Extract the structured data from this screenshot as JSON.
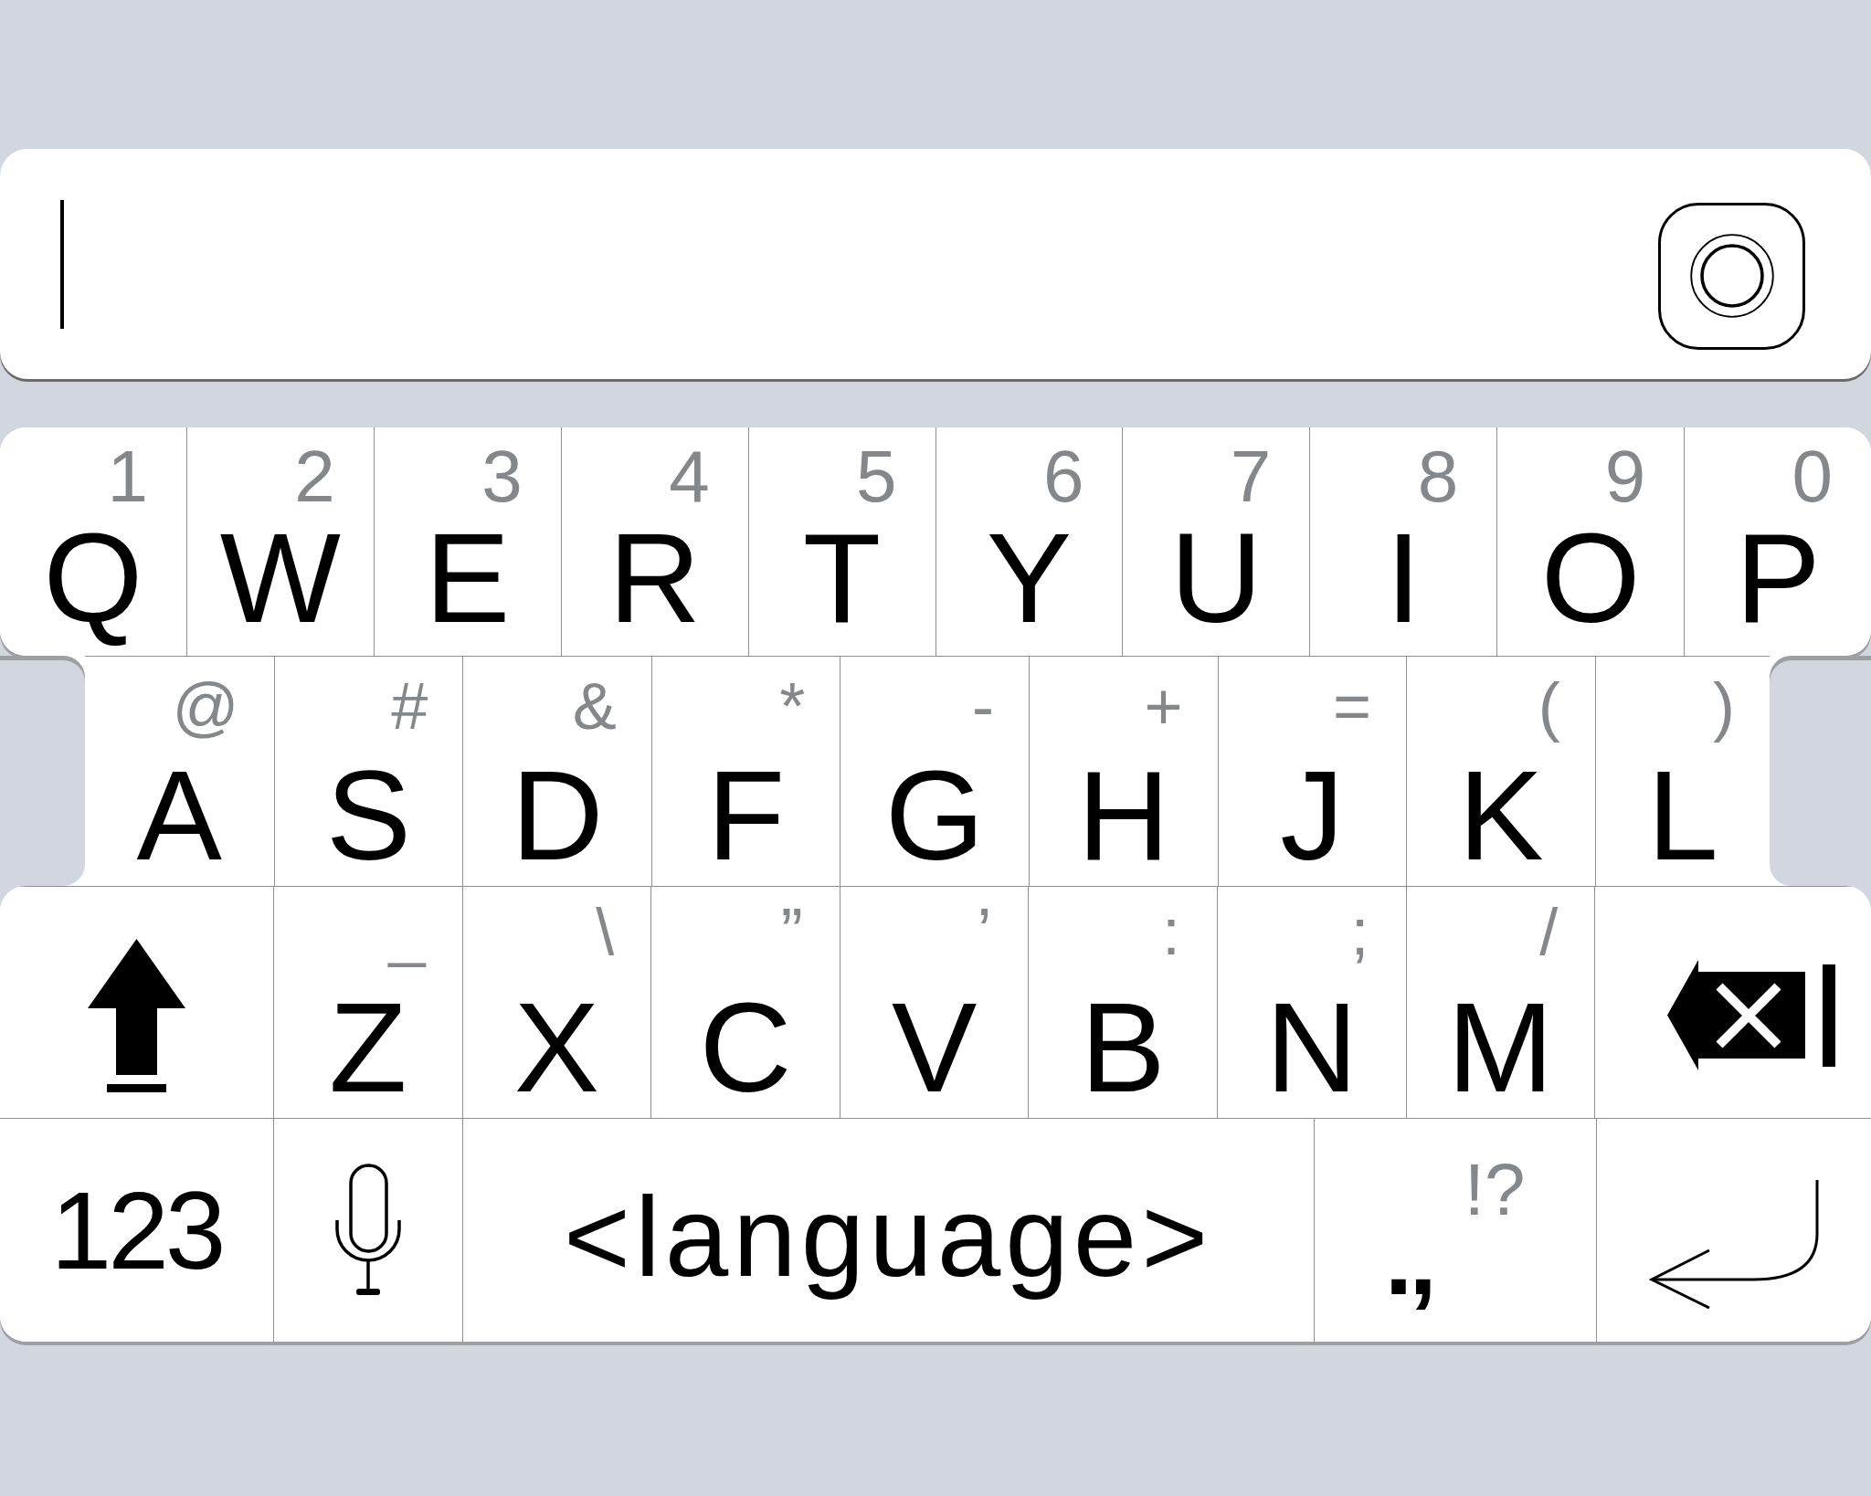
{
  "text_field": {
    "focused": true
  },
  "keyboard": {
    "rows": [
      {
        "keys": [
          {
            "kind": "letter",
            "label": "Q",
            "secondary": "1"
          },
          {
            "kind": "letter",
            "label": "W",
            "secondary": "2"
          },
          {
            "kind": "letter",
            "label": "E",
            "secondary": "3"
          },
          {
            "kind": "letter",
            "label": "R",
            "secondary": "4"
          },
          {
            "kind": "letter",
            "label": "T",
            "secondary": "5"
          },
          {
            "kind": "letter",
            "label": "Y",
            "secondary": "6"
          },
          {
            "kind": "letter",
            "label": "U",
            "secondary": "7"
          },
          {
            "kind": "letter",
            "label": "I",
            "secondary": "8"
          },
          {
            "kind": "letter",
            "label": "O",
            "secondary": "9"
          },
          {
            "kind": "letter",
            "label": "P",
            "secondary": "0"
          }
        ]
      },
      {
        "keys": [
          {
            "kind": "letter",
            "label": "A",
            "secondary": "@"
          },
          {
            "kind": "letter",
            "label": "S",
            "secondary": "#"
          },
          {
            "kind": "letter",
            "label": "D",
            "secondary": "&"
          },
          {
            "kind": "letter",
            "label": "F",
            "secondary": "*"
          },
          {
            "kind": "letter",
            "label": "G",
            "secondary": "-"
          },
          {
            "kind": "letter",
            "label": "H",
            "secondary": "+"
          },
          {
            "kind": "letter",
            "label": "J",
            "secondary": "="
          },
          {
            "kind": "letter",
            "label": "K",
            "secondary": "("
          },
          {
            "kind": "letter",
            "label": "L",
            "secondary": ")"
          }
        ]
      },
      {
        "keys": [
          {
            "kind": "shift",
            "caps_lock": true
          },
          {
            "kind": "letter",
            "label": "Z",
            "secondary": "_"
          },
          {
            "kind": "letter",
            "label": "X",
            "secondary": "\\"
          },
          {
            "kind": "letter",
            "label": "C",
            "secondary": "”"
          },
          {
            "kind": "letter",
            "label": "V",
            "secondary": "’"
          },
          {
            "kind": "letter",
            "label": "B",
            "secondary": ":"
          },
          {
            "kind": "letter",
            "label": "N",
            "secondary": ";"
          },
          {
            "kind": "letter",
            "label": "M",
            "secondary": "/"
          },
          {
            "kind": "backspace"
          }
        ]
      },
      {
        "keys": [
          {
            "kind": "mode",
            "label": "123"
          },
          {
            "kind": "mic"
          },
          {
            "kind": "space",
            "label": "<language>"
          },
          {
            "kind": "punctuation",
            "label": ".,",
            "secondary": "!?"
          },
          {
            "kind": "return"
          }
        ]
      }
    ]
  }
}
